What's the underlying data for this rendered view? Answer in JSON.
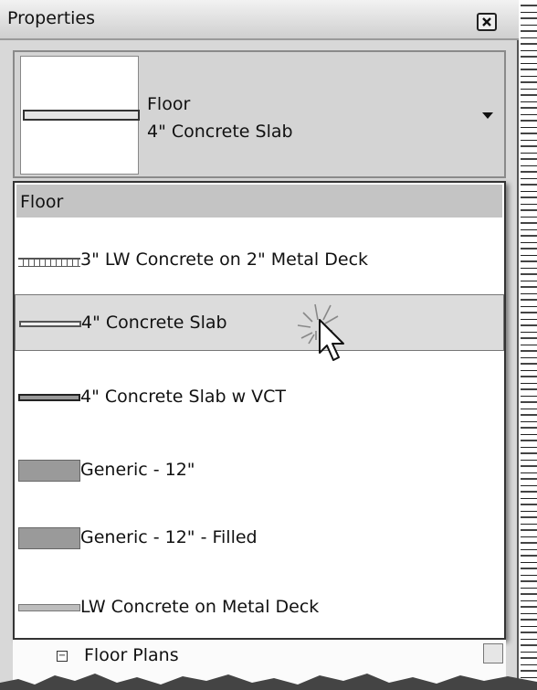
{
  "window": {
    "title": "Properties"
  },
  "type_selector": {
    "family": "Floor",
    "type": "4\" Concrete Slab"
  },
  "dropdown": {
    "group": "Floor",
    "items": [
      {
        "label": "3\" LW Concrete on 2\" Metal Deck",
        "swatch": "metal-deck"
      },
      {
        "label": "4\" Concrete Slab",
        "swatch": "slab",
        "selected": true
      },
      {
        "label": "4\" Concrete Slab w VCT",
        "swatch": "slab-vct"
      },
      {
        "label": "Generic - 12\"",
        "swatch": "generic"
      },
      {
        "label": "Generic - 12\" - Filled",
        "swatch": "generic"
      },
      {
        "label": "LW Concrete on Metal Deck",
        "swatch": "lw-deck"
      }
    ]
  },
  "project_browser": {
    "node": "Floor Plans"
  },
  "colors": {
    "panel": "#d8d8d8",
    "selection": "#dcdcdc",
    "group_header": "#c4c4c4"
  }
}
